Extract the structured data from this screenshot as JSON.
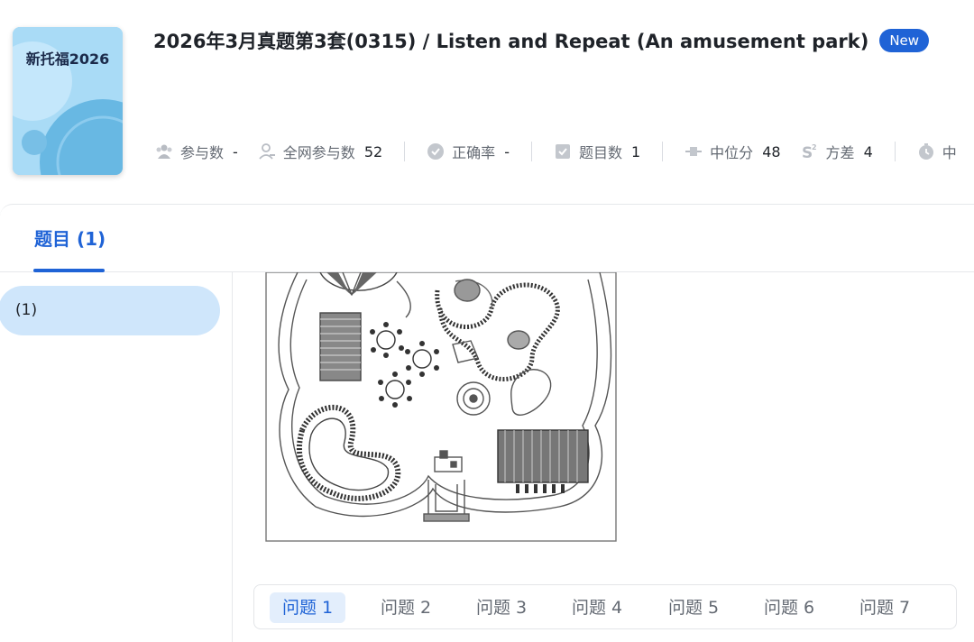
{
  "header": {
    "cover_title": "新托福2026",
    "title": "2026年3月真题第3套(0315) / Listen and Repeat (An amusement park)",
    "badge": "New",
    "stats": [
      {
        "label": "参与数",
        "value": "-",
        "icon": "people-icon"
      },
      {
        "label": "全网参与数",
        "value": "52",
        "icon": "person-icon"
      },
      {
        "label": "正确率",
        "value": "-",
        "icon": "check-circle-icon"
      },
      {
        "label": "题目数",
        "value": "1",
        "icon": "checkbox-icon"
      },
      {
        "label": "中位分",
        "value": "48",
        "icon": "median-icon"
      },
      {
        "label": "方差",
        "value": "4",
        "icon": "variance-icon"
      },
      {
        "label": "中",
        "value": "",
        "icon": "timer-icon"
      }
    ]
  },
  "tabs": {
    "active_label": "题目 (1)"
  },
  "sidebar": {
    "items": [
      {
        "label": "(1)"
      }
    ]
  },
  "questions": {
    "tabs": [
      "问题 1",
      "问题 2",
      "问题 3",
      "问题 4",
      "问题 5",
      "问题 6",
      "问题 7"
    ],
    "active_index": 0
  },
  "colors": {
    "accent": "#1f63d6",
    "sidebar_active_bg": "#cfe6fb",
    "question_active_bg": "#e3eefc"
  }
}
